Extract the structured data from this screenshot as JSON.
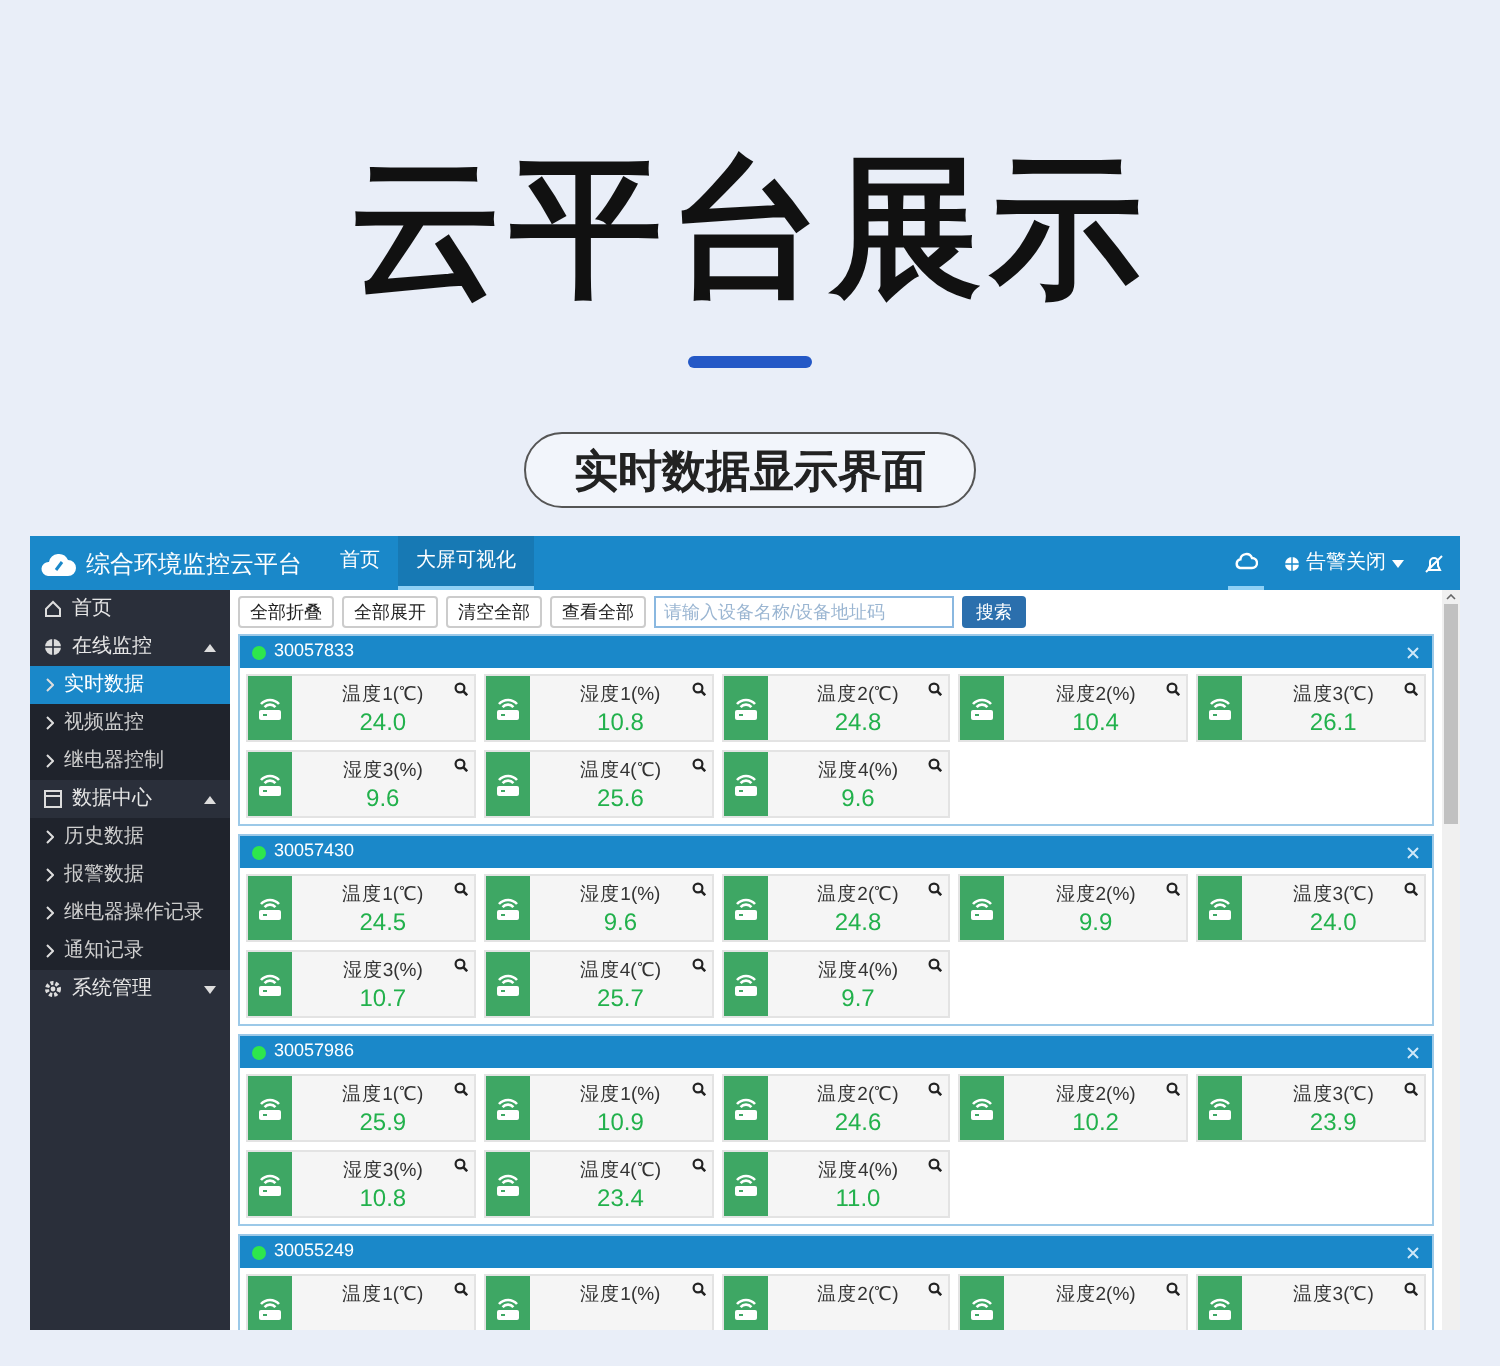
{
  "banner": {
    "title": "云平台展示",
    "subtitle": "实时数据显示界面"
  },
  "app": {
    "title": "综合环境监控云平台",
    "nav": [
      {
        "label": "首页",
        "selected": false
      },
      {
        "label": "大屏可视化",
        "selected": true
      }
    ],
    "alarm": "告警关闭"
  },
  "sidebar": [
    {
      "label": "首页",
      "selected": false
    },
    {
      "label": "在线监控",
      "selected": false,
      "expanded": true,
      "children": [
        {
          "label": "实时数据",
          "selected": true
        },
        {
          "label": "视频监控",
          "selected": false
        },
        {
          "label": "继电器控制",
          "selected": false
        }
      ]
    },
    {
      "label": "数据中心",
      "selected": false,
      "expanded": true,
      "children": [
        {
          "label": "历史数据",
          "selected": false
        },
        {
          "label": "报警数据",
          "selected": false
        },
        {
          "label": "继电器操作记录",
          "selected": false
        },
        {
          "label": "通知记录",
          "selected": false
        }
      ]
    },
    {
      "label": "系统管理",
      "selected": false,
      "expanded": false
    }
  ],
  "toolbar": {
    "buttons": [
      "全部折叠",
      "全部展开",
      "清空全部",
      "查看全部"
    ],
    "search": {
      "placeholder": "请输入设备名称/设备地址码"
    },
    "search_button": "搜索"
  },
  "devices": [
    {
      "id": "30057833",
      "online": true,
      "sensors": [
        {
          "label": "温度1(℃)",
          "value": "24.0"
        },
        {
          "label": "湿度1(%)",
          "value": "10.8"
        },
        {
          "label": "温度2(℃)",
          "value": "24.8"
        },
        {
          "label": "湿度2(%)",
          "value": "10.4"
        },
        {
          "label": "温度3(℃)",
          "value": "26.1"
        },
        {
          "label": "湿度3(%)",
          "value": "9.6"
        },
        {
          "label": "温度4(℃)",
          "value": "25.6"
        },
        {
          "label": "湿度4(%)",
          "value": "9.6"
        }
      ]
    },
    {
      "id": "30057430",
      "online": true,
      "sensors": [
        {
          "label": "温度1(℃)",
          "value": "24.5"
        },
        {
          "label": "湿度1(%)",
          "value": "9.6"
        },
        {
          "label": "温度2(℃)",
          "value": "24.8"
        },
        {
          "label": "湿度2(%)",
          "value": "9.9"
        },
        {
          "label": "温度3(℃)",
          "value": "24.0"
        },
        {
          "label": "湿度3(%)",
          "value": "10.7"
        },
        {
          "label": "温度4(℃)",
          "value": "25.7"
        },
        {
          "label": "湿度4(%)",
          "value": "9.7"
        }
      ]
    },
    {
      "id": "30057986",
      "online": true,
      "sensors": [
        {
          "label": "温度1(℃)",
          "value": "25.9"
        },
        {
          "label": "湿度1(%)",
          "value": "10.9"
        },
        {
          "label": "温度2(℃)",
          "value": "24.6"
        },
        {
          "label": "湿度2(%)",
          "value": "10.2"
        },
        {
          "label": "温度3(℃)",
          "value": "23.9"
        },
        {
          "label": "湿度3(%)",
          "value": "10.8"
        },
        {
          "label": "温度4(℃)",
          "value": "23.4"
        },
        {
          "label": "湿度4(%)",
          "value": "11.0"
        }
      ]
    },
    {
      "id": "30055249",
      "online": true,
      "sensors": [
        {
          "label": "温度1(℃)"
        },
        {
          "label": "湿度1(%)"
        },
        {
          "label": "温度2(℃)"
        },
        {
          "label": "湿度2(%)"
        },
        {
          "label": "温度3(℃)"
        }
      ]
    }
  ]
}
